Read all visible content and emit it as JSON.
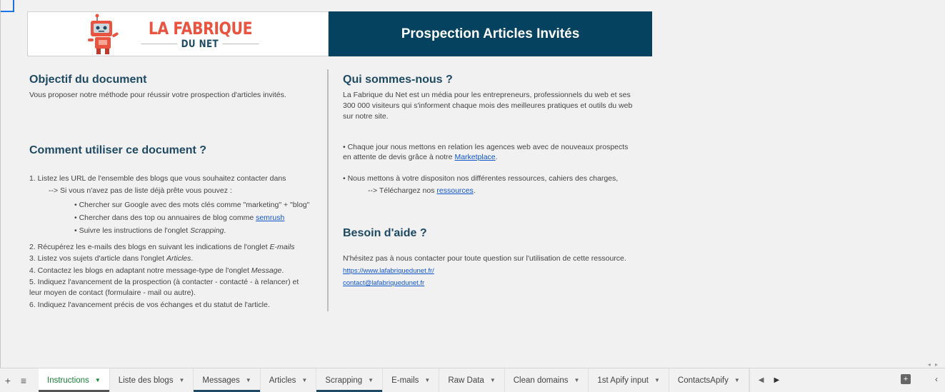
{
  "banner": {
    "logo_line1": "LA FABRIQUE",
    "logo_line2": "DU NET",
    "title": "Prospection Articles Invités"
  },
  "left": {
    "objectif_title": "Objectif du document",
    "objectif_text": "Vous proposer notre méthode pour réussir votre prospection d'articles invités.",
    "comment_title": "Comment utiliser ce document ?",
    "step1": "1. Listez les URL de l'ensemble des blogs que vous souhaitez contacter dans",
    "step1_sub": "--> Si vous n'avez pas de liste déjà prête vous pouvez :",
    "bullet1": "• Chercher sur Google avec des mots clés comme \"marketing\" + \"blog\"",
    "bullet2_prefix": "• Chercher dans des top ou annuaires de blog comme ",
    "bullet2_link": "semrush",
    "bullet3_prefix": "• Suivre les instructions de l'onglet ",
    "bullet3_em": "Scrapping",
    "bullet3_suffix": ".",
    "step2_prefix": "2. Récupérez les e-mails des blogs en suivant les indications de l'onglet ",
    "step2_em": "E-mails",
    "step3_prefix": "3. Listez vos sujets d'article dans l'onglet ",
    "step3_em": "Articles",
    "step3_suffix": ".",
    "step4_prefix": "4. Contactez les blogs en adaptant notre message-type de l'onglet ",
    "step4_em": "Message",
    "step4_suffix": ".",
    "step5_line1": "5. Indiquez l'avancement de la prospection (à contacter - contacté - à relancer) et",
    "step5_line2": "leur moyen de contact (formulaire - mail ou autre).",
    "step6": "6. Indiquez l'avancement précis de vos échanges et du statut de l'article."
  },
  "right": {
    "qui_title": "Qui sommes-nous ?",
    "qui_line1": "La Fabrique du Net est un média pour les entrepreneurs, professionnels du web et ses",
    "qui_line2": "300 000 visiteurs qui s'informent chaque mois des meilleures pratiques et outils du web",
    "qui_line3": "sur notre site.",
    "point1_line1": " • Chaque jour nous mettons en relation les agences web avec de nouveaux prospects",
    "point1_line2_prefix": "en attente de devis grâce à notre ",
    "point1_link": "Marketplace",
    "point1_suffix": ".",
    "point2_line1": "• Nous mettons à votre dispositon nos différentes ressources, cahiers des charges,",
    "point2_line2_prefix": "--> Téléchargez nos ",
    "point2_link": "ressources",
    "point2_suffix": ".",
    "aide_title": "Besoin d'aide ?",
    "aide_text": "N'hésitez pas à nous contacter pour toute question sur l'utilisation de cette ressource.",
    "site_link": "https://www.lafabriquedunet.fr/",
    "email_link": "contact@lafabriquedunet.fr"
  },
  "tabs": [
    {
      "label": "Instructions",
      "active": true
    },
    {
      "label": "Liste des blogs"
    },
    {
      "label": "Messages"
    },
    {
      "label": "Articles"
    },
    {
      "label": "Scrapping"
    },
    {
      "label": "E-mails"
    },
    {
      "label": "Raw Data"
    },
    {
      "label": "Clean domains"
    },
    {
      "label": "1st Apify input"
    },
    {
      "label": "ContactsApify"
    }
  ],
  "colors": {
    "banner_bg": "#054260",
    "heading": "#1e4a63",
    "logo_orange": "#e8543f",
    "active_tab_text": "#188038"
  }
}
